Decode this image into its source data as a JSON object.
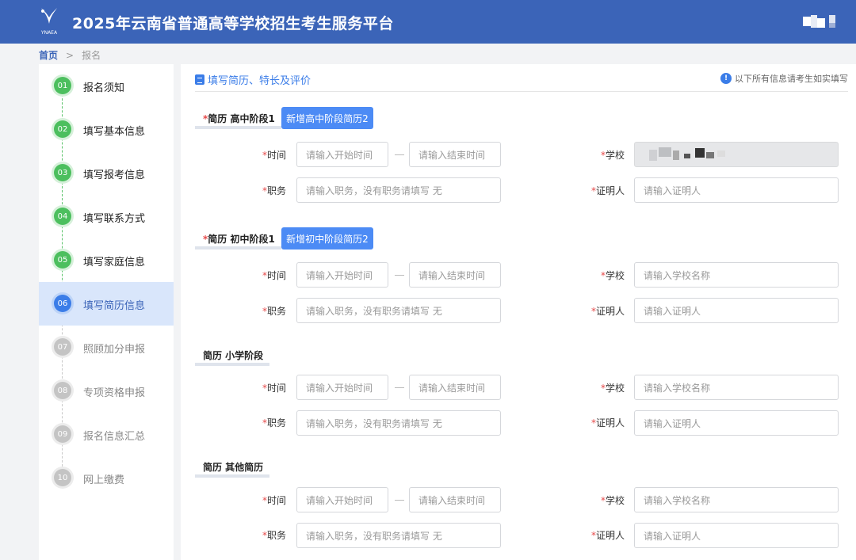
{
  "header": {
    "logo_text": "YNAEA",
    "title": "2025年云南省普通高等学校招生考生服务平台"
  },
  "breadcrumb": {
    "home": "首页",
    "separator": ">",
    "current": "报名"
  },
  "steps": [
    {
      "num": "01",
      "label": "报名须知",
      "state": "done"
    },
    {
      "num": "02",
      "label": "填写基本信息",
      "state": "done"
    },
    {
      "num": "03",
      "label": "填写报考信息",
      "state": "done"
    },
    {
      "num": "04",
      "label": "填写联系方式",
      "state": "done"
    },
    {
      "num": "05",
      "label": "填写家庭信息",
      "state": "done"
    },
    {
      "num": "06",
      "label": "填写简历信息",
      "state": "current"
    },
    {
      "num": "07",
      "label": "照顾加分申报",
      "state": "todo"
    },
    {
      "num": "08",
      "label": "专项资格申报",
      "state": "todo"
    },
    {
      "num": "09",
      "label": "报名信息汇总",
      "state": "todo"
    },
    {
      "num": "10",
      "label": "网上缴费",
      "state": "todo"
    }
  ],
  "main": {
    "section_title": "填写简历、特长及评价",
    "notice": "以下所有信息请考生如实填写",
    "required_mark": "*",
    "labels": {
      "time": "时间",
      "school": "学校",
      "position": "职务",
      "witness": "证明人"
    },
    "placeholders": {
      "start": "请输入开始时间",
      "end": "请输入结束时间",
      "school": "请输入学校名称",
      "position": "请输入职务，没有职务请填写 无",
      "witness": "请输入证明人"
    },
    "groups": [
      {
        "title": "简历 高中阶段1",
        "required": true,
        "add_button": "新增高中阶段简历2"
      },
      {
        "title": "简历 初中阶段1",
        "required": true,
        "add_button": "新增初中阶段简历2"
      },
      {
        "title": "简历 小学阶段",
        "required": false,
        "add_button": ""
      },
      {
        "title": "简历 其他简历",
        "required": false,
        "add_button": ""
      }
    ]
  },
  "colors": {
    "header_bg": "#3b64b8",
    "accent": "#3b7de8",
    "done": "#4cbf5e",
    "required": "#e64a4a"
  }
}
